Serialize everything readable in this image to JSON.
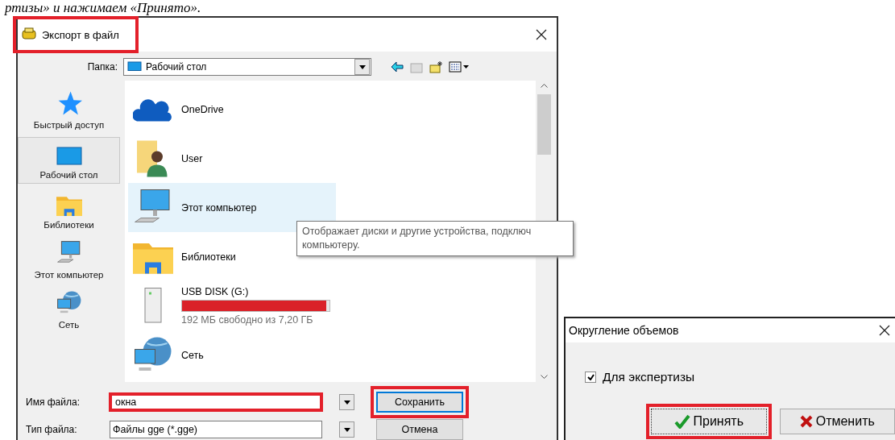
{
  "caption": "ртизы» и нажимаем «Принято».",
  "export_dialog": {
    "title": "Экспорт в файл",
    "highlighted": true,
    "folder_label": "Папка:",
    "folder": "Рабочий стол",
    "sidebar": [
      {
        "label": "Быстрый доступ",
        "kind": "star",
        "selected": false
      },
      {
        "label": "Рабочий стол",
        "kind": "desktop",
        "selected": true
      },
      {
        "label": "Библиотеки",
        "kind": "library",
        "selected": false
      },
      {
        "label": "Этот компьютер",
        "kind": "computer",
        "selected": false
      },
      {
        "label": "Сеть",
        "kind": "network",
        "selected": false
      }
    ],
    "files": [
      {
        "name": "OneDrive",
        "kind": "cloud",
        "hovered": false
      },
      {
        "name": "User",
        "kind": "user",
        "hovered": false
      },
      {
        "name": "Этот компьютер",
        "kind": "computer",
        "hovered": true
      },
      {
        "name": "Библиотеки",
        "kind": "library",
        "hovered": false
      },
      {
        "name": "USB DISK (G:)",
        "kind": "drive",
        "hovered": false,
        "level": 0.98,
        "detail": "192 МБ свободно из 7,20 ГБ"
      },
      {
        "name": "Сеть",
        "kind": "network",
        "hovered": false
      }
    ],
    "tooltip": "Отображает диски и другие устройства, подключ\nкомпьютеру.",
    "file_name_label": "Имя файла:",
    "file_name": {
      "value": "окна",
      "highlighted": true
    },
    "file_type_label": "Тип файла:",
    "file_type": "Файлы gge (*.gge)",
    "buttons": [
      {
        "label": "Сохранить",
        "highlighted": true
      },
      {
        "label": "Отмена",
        "highlighted": false
      }
    ]
  },
  "rounding_dialog": {
    "title": "Округление объемов",
    "checkbox": {
      "label": "Для экспертизы",
      "checked": true
    },
    "buttons": [
      {
        "label": "Принять",
        "kind": "check",
        "highlighted": true
      },
      {
        "label": "Отменить",
        "kind": "cross",
        "highlighted": false
      }
    ]
  }
}
